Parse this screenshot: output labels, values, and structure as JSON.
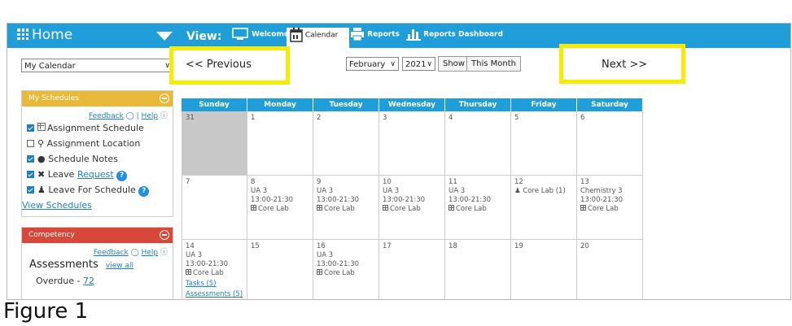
{
  "topbar": {
    "home_label": "Home",
    "view_label": "View:",
    "nav": [
      {
        "label": "Welcome",
        "icon": "monitor-icon"
      },
      {
        "label": "Calendar",
        "icon": "calendar-icon",
        "active": true
      },
      {
        "label": "Reports",
        "icon": "printer-icon"
      },
      {
        "label": "Reports Dashboard",
        "icon": "bar-chart-icon"
      }
    ]
  },
  "controls": {
    "calendar_select": "My Calendar",
    "prev_label": "<< Previous",
    "month_select": "February",
    "year_select": "2021",
    "show_button": "Show",
    "this_month_button": "This Month",
    "next_label": "Next >>",
    "highlight_color": "#f5ec06"
  },
  "schedules_panel": {
    "title": "My Schedules",
    "header_color": "#e9b93a",
    "feedback": "Feedback",
    "help": "Help",
    "separator": "|",
    "items": [
      {
        "label": "Assignment Schedule",
        "checked": true,
        "icon": "grid-icon"
      },
      {
        "label": "Assignment Location",
        "checked": false,
        "icon": "pin-icon"
      },
      {
        "label": "Schedule Notes",
        "checked": true,
        "icon": "comment-icon"
      },
      {
        "label": "Leave",
        "link": "Request",
        "checked": true,
        "icon": "leave-icon",
        "help": true
      },
      {
        "label": "Leave For Schedule",
        "checked": true,
        "icon": "person-icon",
        "help": true
      }
    ],
    "view_link": "View Schedules"
  },
  "competency_panel": {
    "title": "Competency",
    "header_color": "#d9473a",
    "feedback": "Feedback",
    "help": "Help",
    "assessments_title": "Assessments",
    "view_all": "view all",
    "overdue_label": "Overdue - ",
    "overdue_count": "72"
  },
  "calendar": {
    "days": [
      "Sunday",
      "Monday",
      "Tuesday",
      "Wednesday",
      "Thursday",
      "Friday",
      "Saturday"
    ],
    "weeks": [
      [
        {
          "day": "31",
          "gray": true
        },
        {
          "day": "1"
        },
        {
          "day": "2"
        },
        {
          "day": "3"
        },
        {
          "day": "4"
        },
        {
          "day": "5"
        },
        {
          "day": "6"
        }
      ],
      [
        {
          "day": "7"
        },
        {
          "day": "8",
          "lines": [
            "UA 3",
            "13:00-21:30"
          ],
          "lab": "Core Lab"
        },
        {
          "day": "9",
          "lines": [
            "UA 3",
            "13:00-21:30"
          ],
          "lab": "Core Lab"
        },
        {
          "day": "10",
          "lines": [
            "UA 3",
            "13:00-21:30"
          ],
          "lab": "Core Lab"
        },
        {
          "day": "11",
          "lines": [
            "UA 3",
            "13:00-21:30"
          ],
          "lab": "Core Lab"
        },
        {
          "day": "12",
          "person": "Core Lab (1)"
        },
        {
          "day": "13",
          "lines": [
            "Chemistry 3",
            "13:00-21:30"
          ],
          "lab": "Core Lab"
        }
      ],
      [
        {
          "day": "14",
          "lines": [
            "UA 3",
            "13:00-21:30"
          ],
          "lab": "Core Lab",
          "links": [
            "Tasks (5)",
            "Assessments (5)"
          ]
        },
        {
          "day": "15"
        },
        {
          "day": "16",
          "lines": [
            "UA 3",
            "13:00-21:30"
          ],
          "lab": "Core Lab"
        },
        {
          "day": "17"
        },
        {
          "day": "18"
        },
        {
          "day": "19"
        },
        {
          "day": "20"
        }
      ]
    ]
  },
  "caption": "Figure 1"
}
